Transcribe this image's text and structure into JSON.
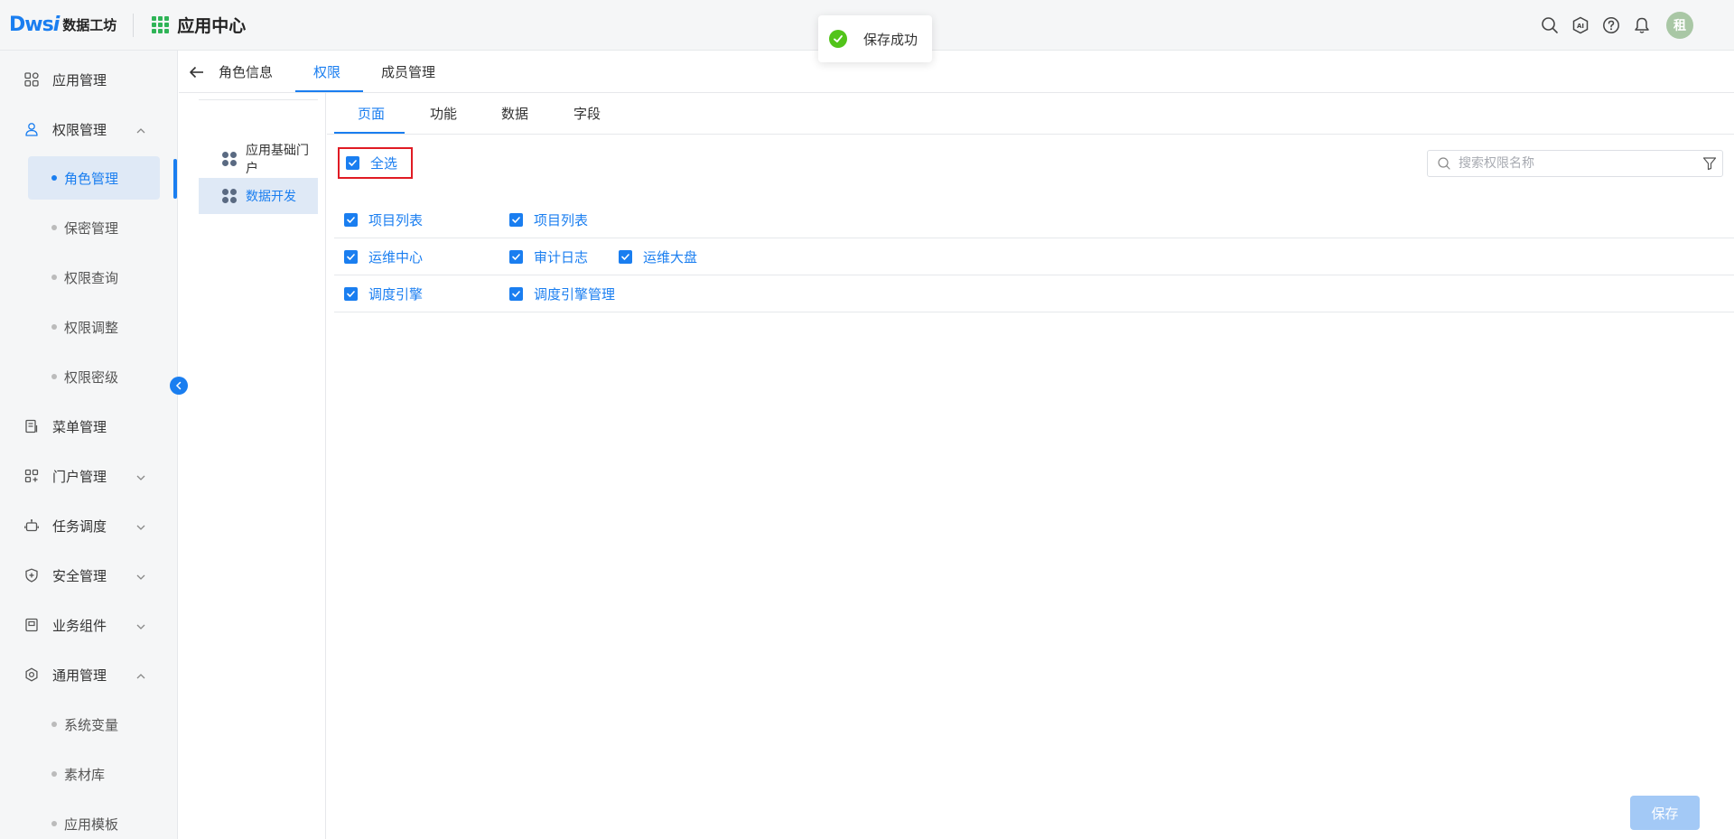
{
  "header": {
    "logo_mark": "Dws",
    "logo_mark_i": "i",
    "logo_text": "数据工坊",
    "app_center": "应用中心",
    "avatar_text": "租"
  },
  "toast": {
    "message": "保存成功"
  },
  "sidebar": {
    "items": [
      {
        "label": "应用管理"
      },
      {
        "label": "权限管理"
      },
      {
        "label": "菜单管理"
      },
      {
        "label": "门户管理"
      },
      {
        "label": "任务调度"
      },
      {
        "label": "安全管理"
      },
      {
        "label": "业务组件"
      },
      {
        "label": "通用管理"
      }
    ],
    "perm_sub": [
      "角色管理",
      "保密管理",
      "权限查询",
      "权限调整",
      "权限密级"
    ],
    "general_sub": [
      "系统变量",
      "素材库",
      "应用模板"
    ]
  },
  "top_tabs": [
    "角色信息",
    "权限",
    "成员管理"
  ],
  "app_list": [
    "应用基础门户",
    "数据开发"
  ],
  "sub_tabs": [
    "页面",
    "功能",
    "数据",
    "字段"
  ],
  "select_all_label": "全选",
  "search": {
    "placeholder": "搜索权限名称"
  },
  "permissions": [
    [
      "项目列表",
      "项目列表"
    ],
    [
      "运维中心",
      "审计日志",
      "运维大盘"
    ],
    [
      "调度引擎",
      "调度引擎管理"
    ]
  ],
  "save_label": "保存",
  "colors": {
    "primary": "#1a7ef0",
    "success": "#52c41a",
    "highlight_border": "#e01b24"
  }
}
